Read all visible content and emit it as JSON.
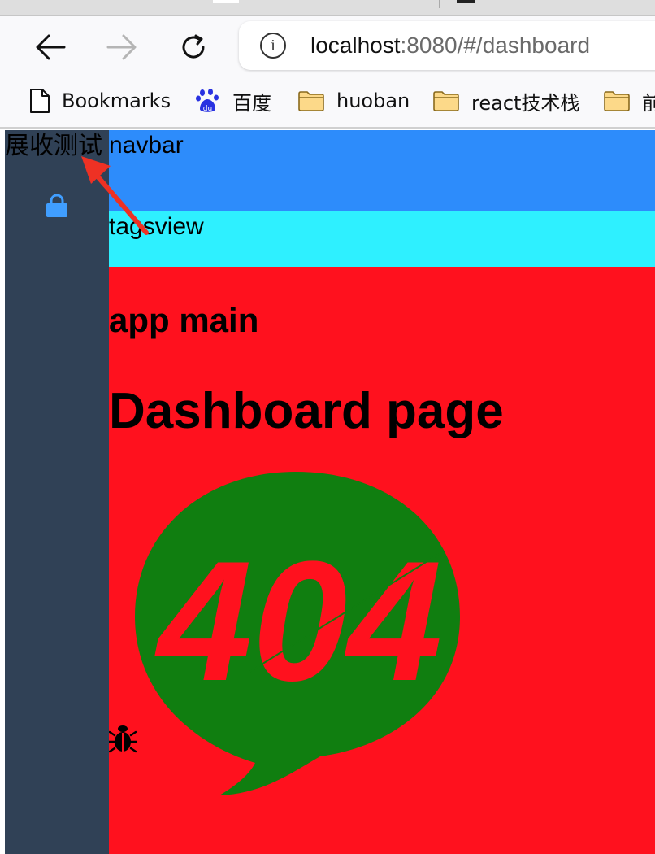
{
  "browser": {
    "url": {
      "host": "localhost",
      "rest": ":8080/#/dashboard"
    },
    "info_glyph": "i",
    "bookmarks": [
      {
        "label": "Bookmarks",
        "icon": "document-icon"
      },
      {
        "label": "百度",
        "icon": "baidu-icon"
      },
      {
        "label": "huoban",
        "icon": "folder-icon"
      },
      {
        "label": "react技术栈",
        "icon": "folder-icon"
      },
      {
        "label": "前",
        "icon": "folder-icon"
      }
    ]
  },
  "app": {
    "sidebar": {
      "toggle_label": "展收测试"
    },
    "navbar": {
      "label": "navbar"
    },
    "tagsview": {
      "label": "tagsview"
    },
    "main": {
      "heading": "app main",
      "page_title": "Dashboard page",
      "error_image_text": "404"
    }
  },
  "colors": {
    "sidebar": "#304156",
    "navbar": "#2d8cfb",
    "tagsview": "#2ef0ff",
    "main": "#ff111e",
    "bubble": "#107e10",
    "lock_icon": "#409eff",
    "annotation_arrow": "#ee3124"
  }
}
